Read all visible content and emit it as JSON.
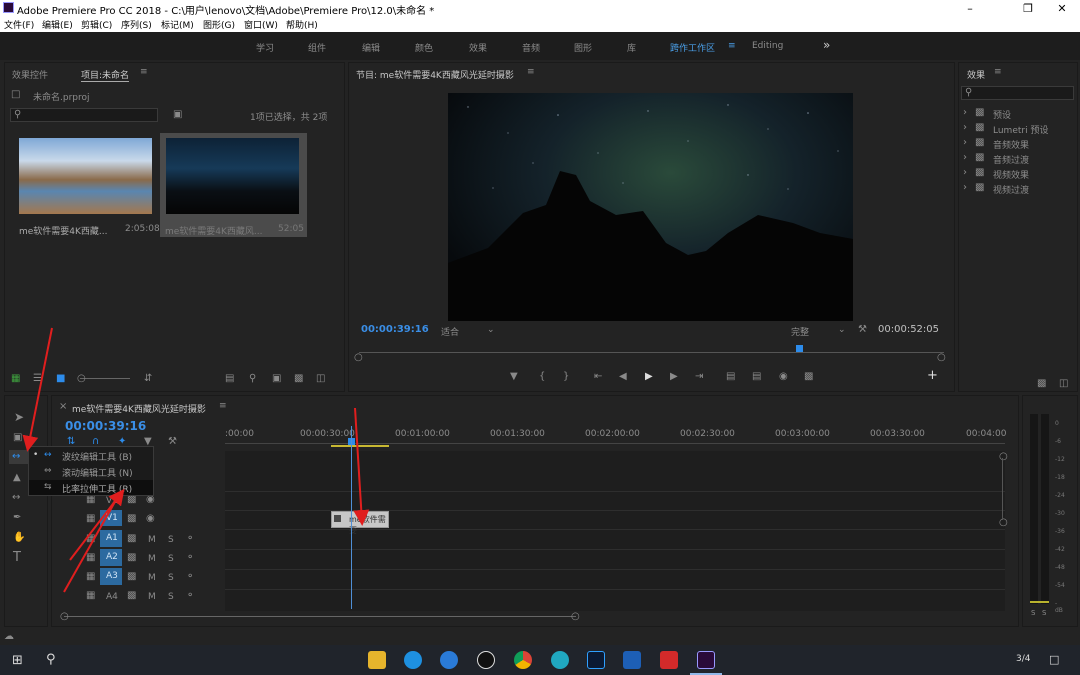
{
  "window": {
    "title": "Adobe Premiere Pro CC 2018 - C:\\用户\\lenovo\\文档\\Adobe\\Premiere Pro\\12.0\\未命名 *"
  },
  "menu": [
    "文件(F)",
    "编辑(E)",
    "剪辑(C)",
    "序列(S)",
    "标记(M)",
    "图形(G)",
    "窗口(W)",
    "帮助(H)"
  ],
  "workspaces": [
    "学习",
    "组件",
    "编辑",
    "颜色",
    "效果",
    "音频",
    "图形",
    "库",
    "跨作工作区",
    "Editing"
  ],
  "active_workspace": "跨作工作区",
  "project_panel": {
    "tab_effect_controls": "效果控件",
    "tab_project": "项目:未命名",
    "project_file": "未命名.prproj",
    "selection_info": "1项已选择，共 2项",
    "items": [
      {
        "name": "me软件需要4K西藏...",
        "duration": "2:05:08"
      },
      {
        "name": "me软件需要4K西藏风...",
        "duration": "52:05"
      }
    ]
  },
  "program_monitor": {
    "tab": "节目: me软件需要4K西藏风光延时摄影",
    "current_time": "00:00:39:16",
    "fit": "适合",
    "quality": "完整",
    "duration": "00:00:52:05"
  },
  "effects_panel": {
    "tab": "效果",
    "folders": [
      "预设",
      "Lumetri 预设",
      "音频效果",
      "音频过渡",
      "视频效果",
      "视频过渡"
    ]
  },
  "timeline": {
    "tab": "me软件需要4K西藏风光延时摄影",
    "timecode": "00:00:39:16",
    "ruler": [
      ":00:00",
      "00:00:30:00",
      "00:01:00:00",
      "00:01:30:00",
      "00:02:00:00",
      "00:02:30:00",
      "00:03:00:00",
      "00:03:30:00",
      "00:04:00"
    ],
    "tracks_video": [
      "V2",
      "V1"
    ],
    "tracks_audio": [
      "A1",
      "A2",
      "A3",
      "A4"
    ],
    "clip_label": "me软件需要",
    "track_buttons": {
      "m": "M",
      "s": "S"
    }
  },
  "tool_menu": {
    "items": [
      {
        "label": "波纹编辑工具 (B)",
        "selected": true
      },
      {
        "label": "滚动编辑工具 (N)",
        "selected": false
      },
      {
        "label": "比率拉伸工具 (R)",
        "selected": false
      }
    ]
  },
  "audio_meter": {
    "scale": [
      "0",
      "-6",
      "-12",
      "-18",
      "-24",
      "-30",
      "-36",
      "-42",
      "-48",
      "-54",
      "-dB"
    ],
    "solo": "S"
  },
  "taskbar": {
    "page_indicator": "3/4"
  },
  "colors": {
    "accent_blue": "#2d8ceb",
    "timecode_blue": "#3a8ee6",
    "annotation_red": "#e01e1e",
    "workspace_active": "#4a9fe8",
    "playhead_blue": "#4f8fd6"
  }
}
